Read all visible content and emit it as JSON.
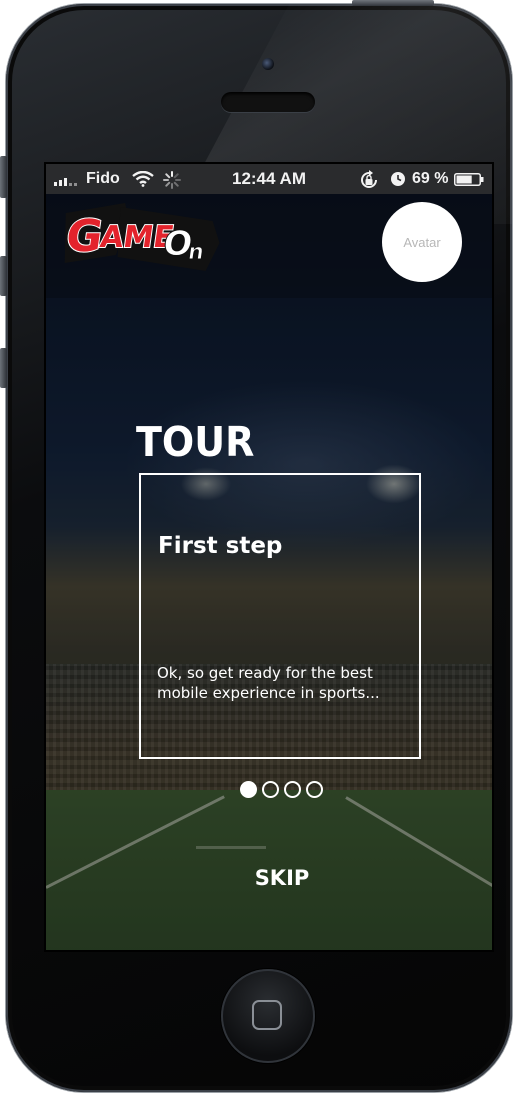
{
  "status_bar": {
    "carrier": "Fido",
    "time": "12:44 AM",
    "battery_percent": "69 %",
    "battery_level": 0.69,
    "icons": [
      "signal-icon",
      "wifi-icon",
      "activity-spinner-icon",
      "rotation-lock-icon",
      "alarm-icon",
      "battery-icon"
    ]
  },
  "header": {
    "logo_text": "GameOn",
    "avatar_label": "Avatar"
  },
  "tour": {
    "title": "TOUR",
    "step_title": "First step",
    "step_body": "Ok, so get ready for the best mobile experience in sports...",
    "pages": 4,
    "current_page": 1,
    "skip_label": "SKIP"
  },
  "colors": {
    "logo_red": "#e3232c",
    "logo_black": "#111111",
    "text": "#ffffff"
  }
}
